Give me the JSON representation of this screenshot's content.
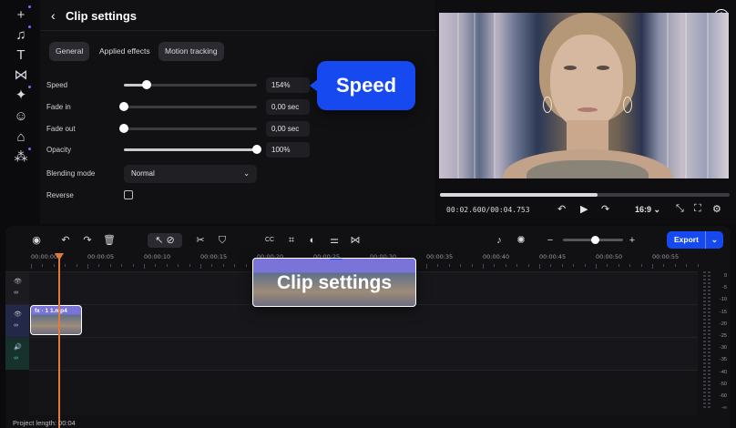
{
  "rail": {
    "items": [
      {
        "icon": "plus-icon",
        "glyph": "+"
      },
      {
        "icon": "music-icon",
        "glyph": "♫"
      },
      {
        "icon": "text-icon",
        "glyph": "T"
      },
      {
        "icon": "transitions-icon",
        "glyph": "⋈"
      },
      {
        "icon": "effects-icon",
        "glyph": "✦"
      },
      {
        "icon": "stickers-icon",
        "glyph": "☺"
      },
      {
        "icon": "brand-kit-icon",
        "glyph": "⌂"
      },
      {
        "icon": "templates-icon",
        "glyph": "⁂"
      }
    ]
  },
  "panel": {
    "back_glyph": "‹",
    "title": "Clip settings",
    "tabs": [
      "General",
      "Applied effects",
      "Motion tracking"
    ],
    "rows": {
      "speed": {
        "label": "Speed",
        "value": "154%",
        "level": 0.17
      },
      "fade_in": {
        "label": "Fade in",
        "value": "0,00 sec",
        "level": 0.0
      },
      "fade_out": {
        "label": "Fade out",
        "value": "0,00 sec",
        "level": 0.0
      },
      "opacity": {
        "label": "Opacity",
        "value": "100%",
        "level": 1.0
      },
      "blending": {
        "label": "Blending mode",
        "value": "Normal",
        "chevron": "⌄"
      },
      "reverse": {
        "label": "Reverse",
        "checked": false
      }
    }
  },
  "callouts": {
    "speed": "Speed",
    "clip_settings": "Clip settings"
  },
  "preview": {
    "help_glyph": "?",
    "time_current": "00:02.600",
    "time_sep": "/",
    "time_total": "00:04.753",
    "progress": 0.545,
    "ratio": "16:9",
    "controls": {
      "undo": "↶",
      "play": "▶",
      "redo": "↷",
      "ratio_caret": "⌄",
      "fit": "⤡",
      "fullscreen": "⛶",
      "settings": "⚙"
    }
  },
  "timeline": {
    "tools": {
      "record": "◉",
      "undo": "↶",
      "redo": "↷",
      "delete": "🗑",
      "select": "↖",
      "tag": "⊘",
      "cut": "✂",
      "shield": "⛉",
      "cc": "CC",
      "crop": "⌗",
      "color": "◐",
      "clip_settings": "⚌",
      "transition": "⋈",
      "audio": "♪",
      "magic": "✺",
      "zoom_out": "−",
      "zoom_in": "+"
    },
    "zoom_level": 0.5,
    "export_label": "Export",
    "export_caret": "⌄",
    "ruler": [
      "00:00:00",
      "00:00:05",
      "00:00:10",
      "00:00:15",
      "00:00:20",
      "00:00:25",
      "00:00:30",
      "00:00:35",
      "00:00:40",
      "00:00:45",
      "00:00:50",
      "00:00:55"
    ],
    "clip": {
      "label": "fx · 1  1.mp4"
    },
    "track_icons": {
      "eye": "👁",
      "link": "∞",
      "sound": "🔊"
    },
    "meter_labels": [
      "0",
      "-5",
      "-10",
      "-15",
      "-20",
      "-25",
      "-30",
      "-35",
      "-40",
      "-50",
      "-60",
      "-∞"
    ],
    "project_length": "Project length: 00:04"
  }
}
